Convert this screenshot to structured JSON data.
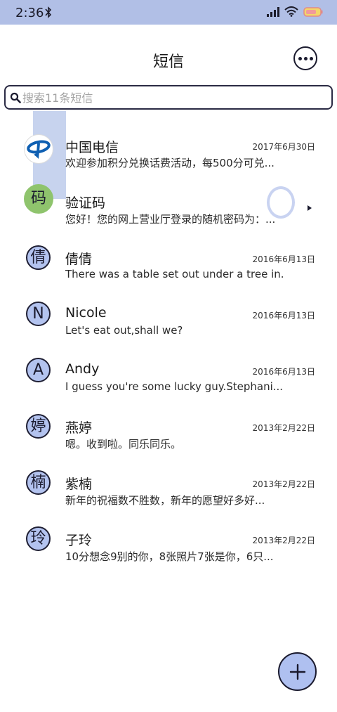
{
  "status_bar": {
    "time": "2:36"
  },
  "header": {
    "title": "短信"
  },
  "search": {
    "placeholder": "搜索11条短信"
  },
  "conversations": [
    {
      "name": "中国电信",
      "date": "2017年6月30日",
      "preview": "欢迎参加积分兑换话费活动，每500分可兑...",
      "avatar_type": "logo",
      "avatar_icon": "china-telecom-logo"
    },
    {
      "name": "验证码",
      "date": "",
      "preview": "您好！您的网上营业厅登录的随机密码为：...",
      "avatar_char": "码",
      "avatar_color": "#8fc46d"
    },
    {
      "name": "倩倩",
      "date": "2016年6月13日",
      "preview": "There was a table set out under a tree in...",
      "avatar_char": "倩"
    },
    {
      "name": "Nicole",
      "date": "2016年6月13日",
      "preview": "Let's eat out,shall we?",
      "avatar_char": "N"
    },
    {
      "name": "Andy",
      "date": "2016年6月13日",
      "preview": "I guess you're some lucky guy.Stephani...",
      "avatar_char": "A"
    },
    {
      "name": "燕婷",
      "date": "2013年2月22日",
      "preview": "嗯。收到啦。同乐同乐。",
      "avatar_char": "婷"
    },
    {
      "name": "紫楠",
      "date": "2013年2月22日",
      "preview": "新年的祝福数不胜数，新年的愿望好多好...",
      "avatar_char": "楠"
    },
    {
      "name": "子玲",
      "date": "2013年2月22日",
      "preview": "10分想念9别的你，8张照片7张是你，6只...",
      "avatar_char": "玲"
    }
  ],
  "colors": {
    "status_bar": "#b1bfe6",
    "avatar_fill": "#b3c3ef",
    "fab_fill": "#afc0f0"
  }
}
